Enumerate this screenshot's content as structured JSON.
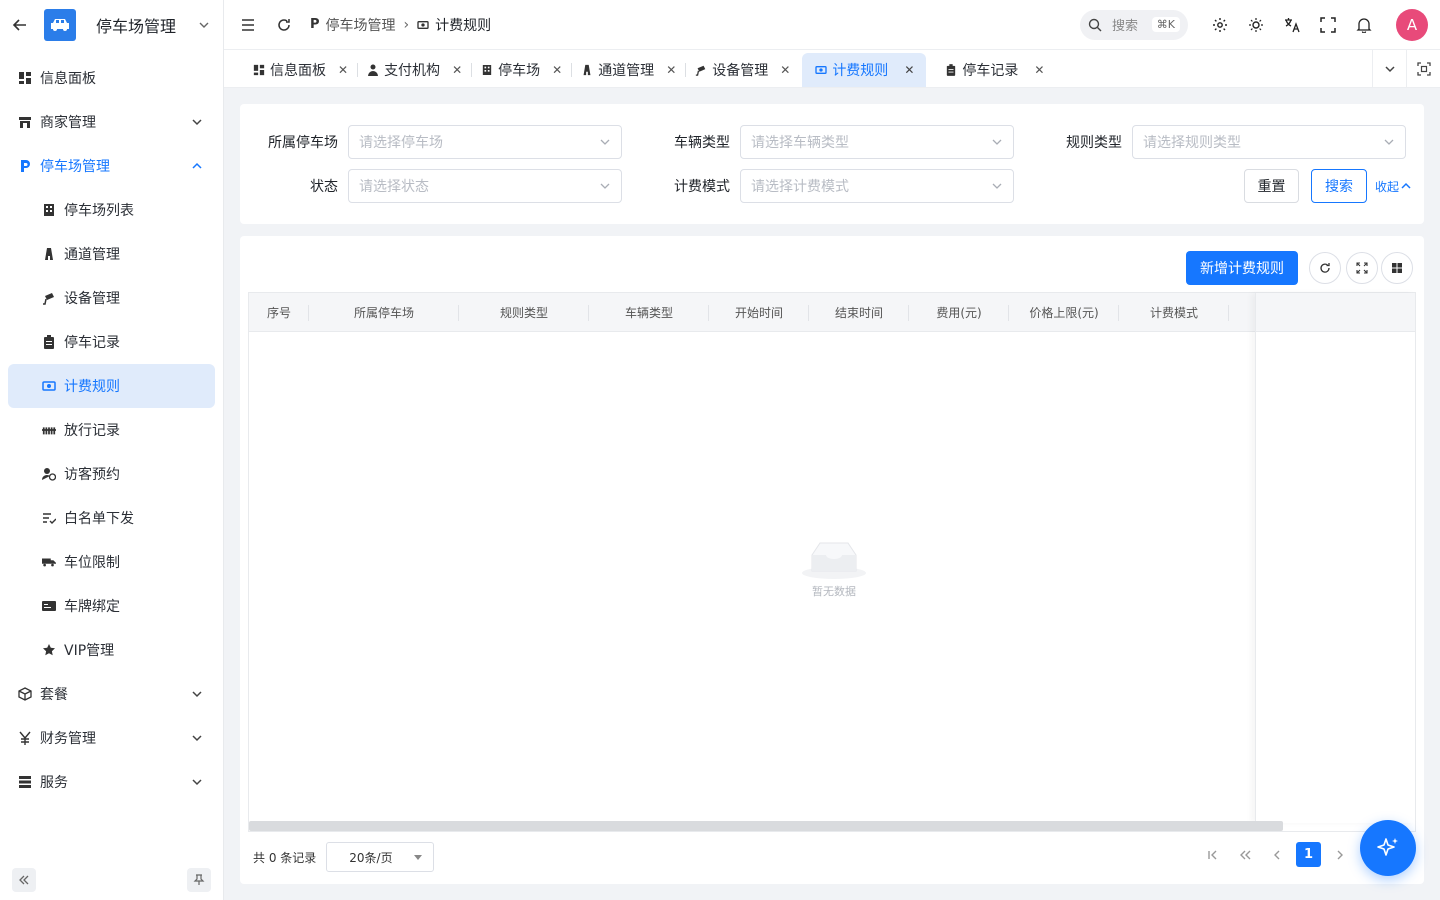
{
  "app": {
    "title": "停车场管理"
  },
  "sidebar": {
    "items": [
      {
        "label": "信息面板",
        "icon": "dashboard-icon"
      },
      {
        "label": "商家管理",
        "icon": "store-icon"
      },
      {
        "label": "停车场管理",
        "icon": "parking-icon"
      },
      {
        "label": "停车场列表",
        "icon": "building-icon"
      },
      {
        "label": "通道管理",
        "icon": "road-icon"
      },
      {
        "label": "设备管理",
        "icon": "camera-icon"
      },
      {
        "label": "停车记录",
        "icon": "clipboard-icon"
      },
      {
        "label": "计费规则",
        "icon": "money-icon"
      },
      {
        "label": "放行记录",
        "icon": "barrier-icon"
      },
      {
        "label": "访客预约",
        "icon": "visitor-icon"
      },
      {
        "label": "白名单下发",
        "icon": "list-check-icon"
      },
      {
        "label": "车位限制",
        "icon": "truck-icon"
      },
      {
        "label": "车牌绑定",
        "icon": "card-icon"
      },
      {
        "label": "VIP管理",
        "icon": "star-icon"
      },
      {
        "label": "套餐",
        "icon": "package-icon"
      },
      {
        "label": "财务管理",
        "icon": "yuan-icon"
      },
      {
        "label": "服务",
        "icon": "server-icon"
      }
    ]
  },
  "header": {
    "breadcrumb": [
      "停车场管理",
      "计费规则"
    ],
    "search_placeholder": "搜索",
    "search_shortcut": "⌘K",
    "avatar": "A"
  },
  "tabs": [
    {
      "label": "信息面板"
    },
    {
      "label": "支付机构"
    },
    {
      "label": "停车场"
    },
    {
      "label": "通道管理"
    },
    {
      "label": "设备管理"
    },
    {
      "label": "计费规则"
    },
    {
      "label": "停车记录"
    }
  ],
  "filters": {
    "parking_lot": {
      "label": "所属停车场",
      "placeholder": "请选择停车场"
    },
    "vehicle_type": {
      "label": "车辆类型",
      "placeholder": "请选择车辆类型"
    },
    "rule_type": {
      "label": "规则类型",
      "placeholder": "请选择规则类型"
    },
    "status": {
      "label": "状态",
      "placeholder": "请选择状态"
    },
    "billing_mode": {
      "label": "计费模式",
      "placeholder": "请选择计费模式"
    },
    "reset_label": "重置",
    "search_label": "搜索",
    "collapse_label": "收起"
  },
  "toolbar": {
    "add_label": "新增计费规则"
  },
  "table": {
    "columns": [
      "序号",
      "所属停车场",
      "规则类型",
      "车辆类型",
      "开始时间",
      "结束时间",
      "费用(元)",
      "价格上限(元)",
      "计费模式"
    ],
    "rows": [],
    "empty_text": "暂无数据"
  },
  "pagination": {
    "total_text": "共 0 条记录",
    "page_size": "20条/页",
    "current_page": "1"
  },
  "colors": {
    "primary": "#1677ff",
    "avatar": "#e84a7a"
  }
}
